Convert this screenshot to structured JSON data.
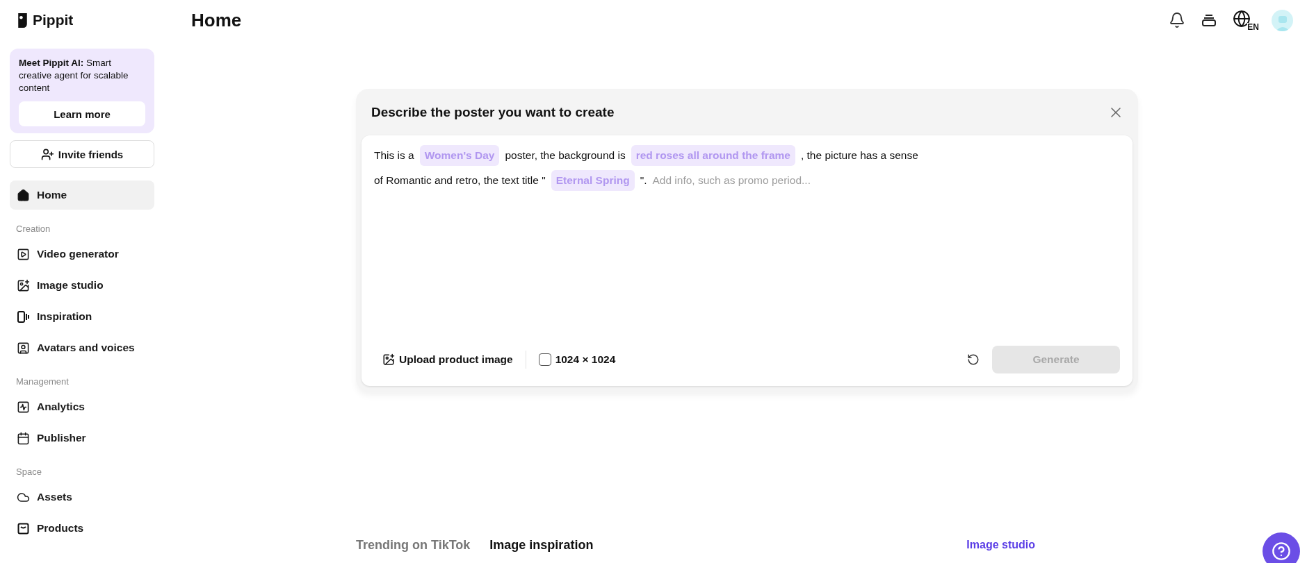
{
  "logo": {
    "name": "Pippit"
  },
  "promo": {
    "title": "Meet Pippit AI:",
    "text": "Smart creative agent for scalable content",
    "button": "Learn more"
  },
  "invite": {
    "label": "Invite friends"
  },
  "sidebar": {
    "items": [
      {
        "label": "Home",
        "selected": true
      }
    ],
    "sections": [
      {
        "title": "Creation",
        "items": [
          {
            "label": "Video generator",
            "selected": false
          },
          {
            "label": "Image studio",
            "selected": false
          },
          {
            "label": "Inspiration",
            "selected": false
          },
          {
            "label": "Avatars and voices",
            "selected": false
          }
        ]
      },
      {
        "title": "Management",
        "items": [
          {
            "label": "Analytics",
            "selected": false
          },
          {
            "label": "Publisher",
            "selected": false
          }
        ]
      },
      {
        "title": "Space",
        "items": [
          {
            "label": "Assets",
            "selected": false
          },
          {
            "label": "Products",
            "selected": false
          }
        ]
      }
    ]
  },
  "header": {
    "title": "Home",
    "language": "EN"
  },
  "dialog": {
    "title": "Describe the poster you want to create",
    "prompt_lines": [
      [
        {
          "kind": "text",
          "text": "This is a"
        },
        {
          "kind": "tag",
          "text": "Women's Day"
        },
        {
          "kind": "text",
          "text": "poster, the background is"
        },
        {
          "kind": "tag",
          "text": "red roses all around the frame"
        },
        {
          "kind": "text",
          "text": ", the picture has a sense"
        }
      ],
      [
        {
          "kind": "text",
          "text": "of Romantic and retro, the text title \""
        },
        {
          "kind": "tag",
          "text": "Eternal Spring"
        },
        {
          "kind": "text",
          "text": "\"."
        },
        {
          "kind": "placeholder",
          "text": "Add info, such as promo period..."
        }
      ]
    ],
    "upload": "Upload product image",
    "size": {
      "label": "1024 × 1024",
      "checked": false
    },
    "generate": {
      "label": "Generate",
      "disabled": true
    }
  },
  "bottom_tabs": [
    {
      "label": "Trending on TikTok",
      "selected": false
    },
    {
      "label": "Image inspiration",
      "selected": true
    }
  ],
  "bottom_link": "Image studio"
}
